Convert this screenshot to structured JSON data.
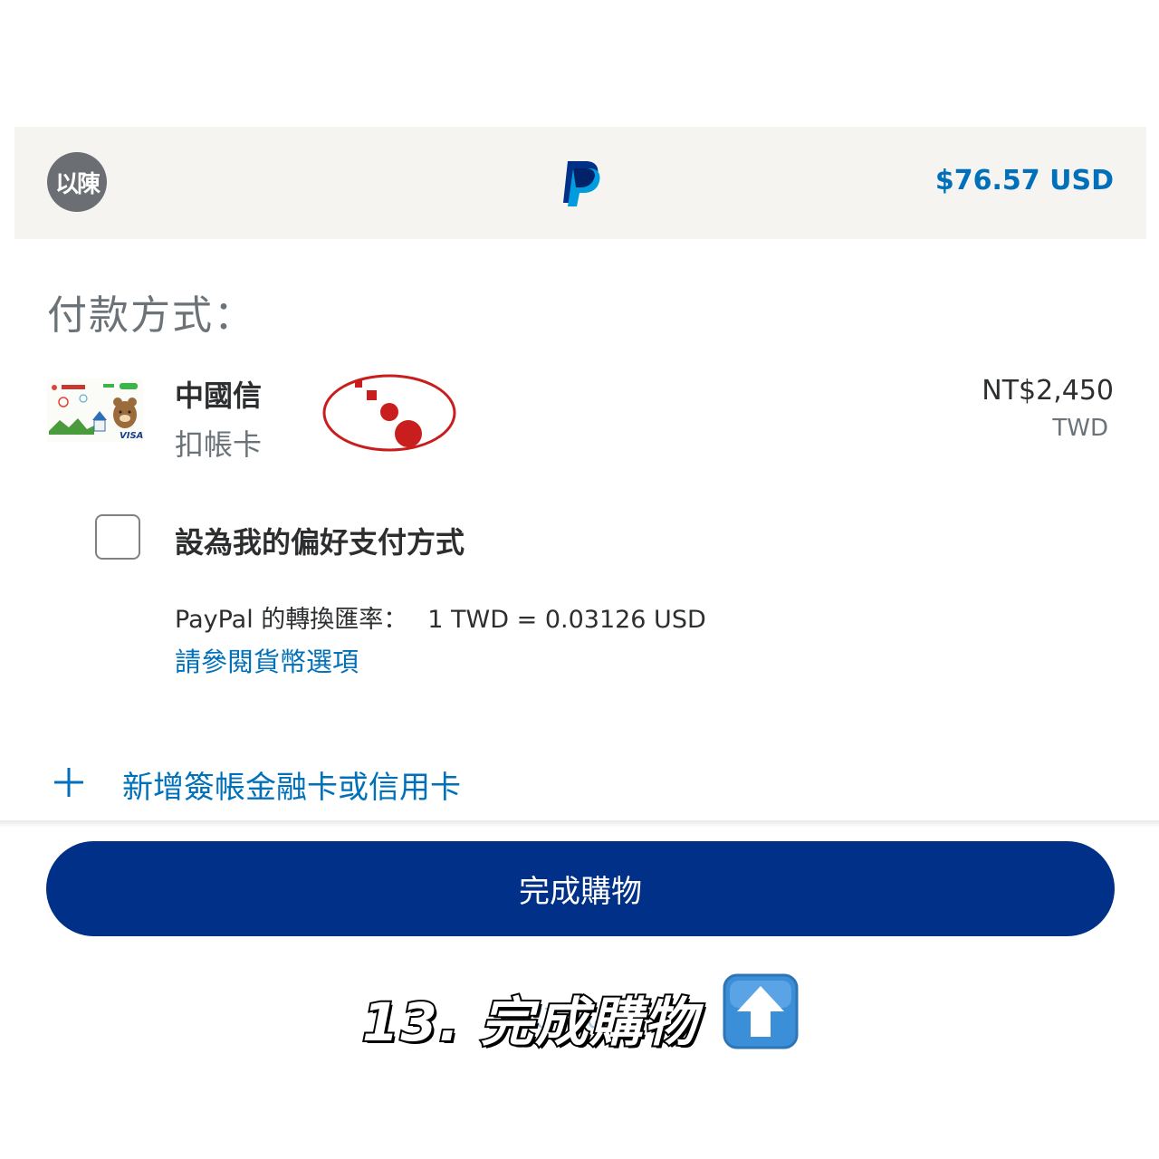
{
  "header": {
    "avatar_text": "以陳",
    "logo_icon": "paypal-logo-icon",
    "amount": "$76.57 USD"
  },
  "payment": {
    "section_title": "付款方式：",
    "card": {
      "bank_name": "中國信",
      "card_type": "扣帳卡",
      "amount": "NT$2,450",
      "currency": "TWD"
    },
    "preferred_label": "設為我的偏好支付方式",
    "rate_label": "PayPal 的轉換匯率：",
    "rate_value": "1 TWD = 0.03126 USD",
    "currency_options_link": "請參閱貨幣選項",
    "add_card_label": "新增簽帳金融卡或信用卡"
  },
  "actions": {
    "complete_label": "完成購物",
    "faded_link": "付款方式"
  },
  "caption": {
    "text": "13. 完成購物",
    "icon": "up-arrow-emoji-icon"
  },
  "colors": {
    "brand_dark": "#003087",
    "link_blue": "#0070ba",
    "header_bg": "#f5f4f1"
  }
}
